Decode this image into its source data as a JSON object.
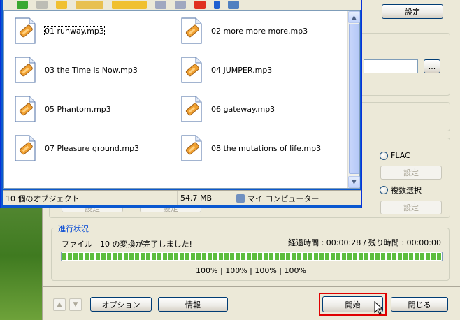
{
  "settings_top_label": "設定",
  "browse_label": "...",
  "flac_label": "FLAC",
  "settings_flac_label": "設定",
  "multi_select_label": "複数選択",
  "settings_multi_label": "設定",
  "settings_left1_label": "設定",
  "settings_left2_label": "設定",
  "progress": {
    "legend": "進行状況",
    "status": "ファイル　10 の変換が完了しました!",
    "elapsed": "経過時間 : 00:00:28 / 残り時間 : 00:00:00",
    "percent_value": 100,
    "percents": "100% | 100% | 100% | 100%"
  },
  "bottom": {
    "options_label": "オプション",
    "info_label": "情報",
    "start_label": "開始",
    "close_label": "閉じる"
  },
  "explorer": {
    "files": [
      {
        "name": "01 runway.mp3"
      },
      {
        "name": "02 more more more.mp3"
      },
      {
        "name": "03 the Time is Now.mp3"
      },
      {
        "name": "04 JUMPER.mp3"
      },
      {
        "name": "05 Phantom.mp3"
      },
      {
        "name": "06 gateway.mp3"
      },
      {
        "name": "07 Pleasure ground.mp3"
      },
      {
        "name": "08 the mutations of life.mp3"
      }
    ],
    "status_count": "10 個のオブジェクト",
    "status_size": "54.7 MB",
    "status_location": "マイ コンピューター"
  },
  "colors": {
    "accent": "#0a58d0",
    "progress": "#5ebd3d",
    "focus": "#e00000"
  }
}
